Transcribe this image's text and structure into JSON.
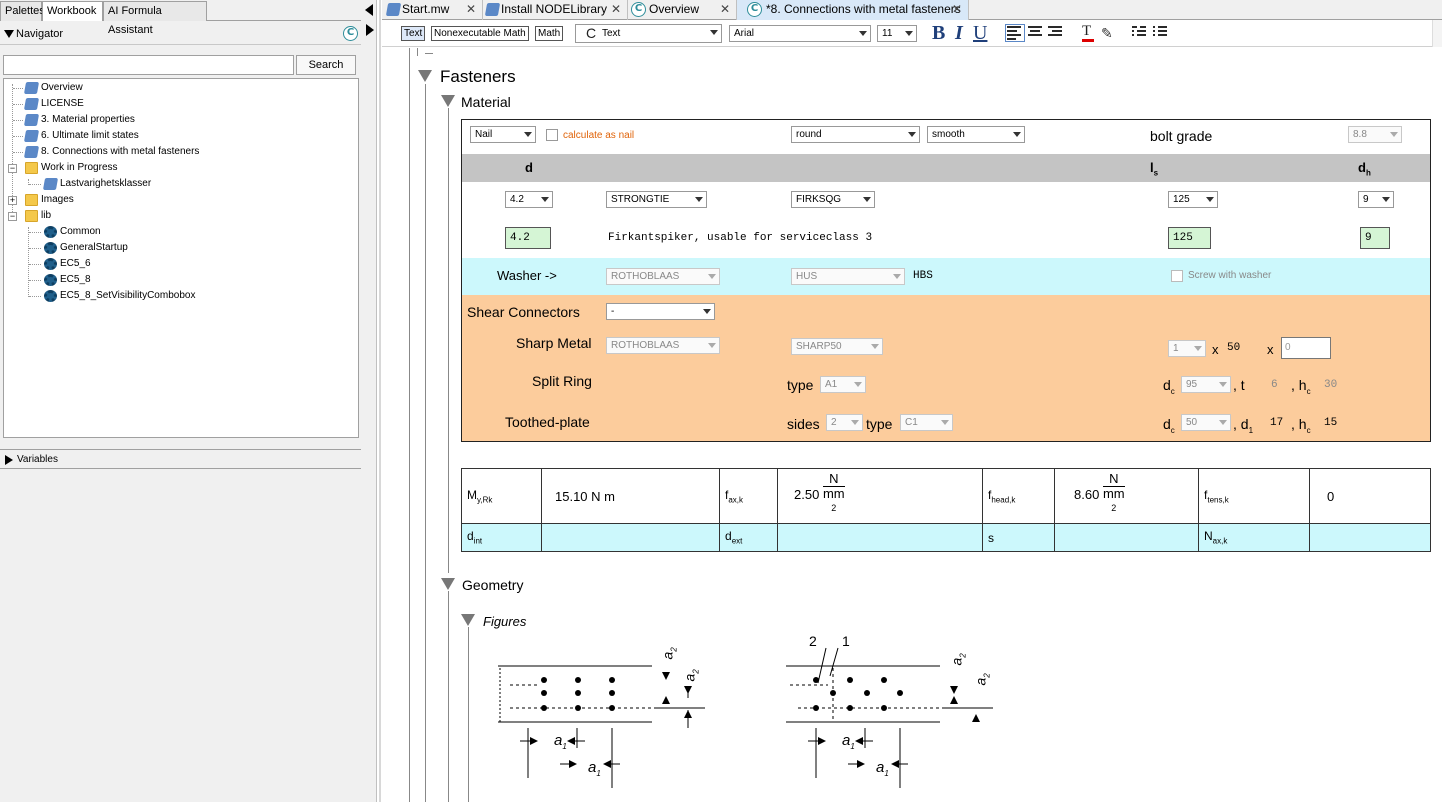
{
  "left_tabs": [
    "Palettes",
    "Workbook",
    "AI Formula Assistant"
  ],
  "navigator": {
    "title": "Navigator",
    "search_label": "Search",
    "search_value": "",
    "tree": [
      {
        "label": "Overview",
        "type": "doc",
        "level": 1
      },
      {
        "label": "LICENSE",
        "type": "doc",
        "level": 1
      },
      {
        "label": "3. Material properties",
        "type": "doc",
        "level": 1
      },
      {
        "label": "6. Ultimate limit states",
        "type": "doc",
        "level": 1
      },
      {
        "label": "8. Connections with metal fasteners",
        "type": "doc",
        "level": 1
      },
      {
        "label": "Work in Progress",
        "type": "folder",
        "level": 1
      },
      {
        "label": "Lastvarighetsklasser",
        "type": "doc",
        "level": 2
      },
      {
        "label": "Images",
        "type": "folder",
        "level": 1
      },
      {
        "label": "lib",
        "type": "folder",
        "level": 1
      },
      {
        "label": "Common",
        "type": "gear",
        "level": 2
      },
      {
        "label": "GeneralStartup",
        "type": "gear",
        "level": 2
      },
      {
        "label": "EC5_6",
        "type": "gear",
        "level": 2
      },
      {
        "label": "EC5_8",
        "type": "gear",
        "level": 2
      },
      {
        "label": "EC5_8_SetVisibilityCombobox",
        "type": "gear",
        "level": 2
      }
    ],
    "variables_label": "Variables"
  },
  "doc_tabs": [
    "Start.mw",
    "Install NODELibrary",
    "Overview",
    "*8. Connections with metal fasteners"
  ],
  "toolbar": {
    "text_btn": "Text",
    "nonexec_btn": "Nonexecutable Math",
    "math_btn": "Math",
    "style": "Text",
    "font": "Arial",
    "size": "11",
    "bold": "B",
    "italic": "I",
    "underline": "U"
  },
  "sections": {
    "fasteners": "Fasteners",
    "material": "Material",
    "geometry": "Geometry",
    "figures": "Figures"
  },
  "material": {
    "type_combo": "Nail",
    "calc_as_nail": "calculate as nail",
    "shape_combo": "round",
    "surface_combo": "smooth",
    "bolt_grade_label": "bolt grade",
    "bolt_grade": "8.8",
    "col_d": "d",
    "col_ls": "l",
    "col_ls_sub": "s",
    "col_dh": "d",
    "col_dh_sub": "h",
    "d_combo": "4.2",
    "maker_combo": "STRONGTIE",
    "product_combo": "FIRKSQG",
    "ls_combo": "125",
    "dh_combo": "9",
    "d_value": "4.2",
    "description": "Firkantspiker, usable for serviceclass 3",
    "ls_value": "125",
    "dh_value": "9",
    "washer_label": "Washer ->",
    "washer_maker": "ROTHOBLAAS",
    "washer_product": "HUS",
    "washer_code": "HBS",
    "screw_with_washer": "Screw with washer",
    "shear_label": "Shear Connectors",
    "shear_combo": "-",
    "sharp_label": "Sharp Metal",
    "sharp_maker": "ROTHOBLAAS",
    "sharp_product": "SHARP50",
    "sharp_count": "1",
    "x1": "x",
    "sharp_len": "50",
    "x2": "x",
    "sharp_input": "0",
    "split_label": "Split Ring",
    "type_label": "type",
    "split_type": "A1",
    "dc_label": "d",
    "dc_sub": "c",
    "split_dc": "95",
    "t_label": ", t",
    "split_t": "6",
    "hc_label": ", h",
    "hc_sub": "c",
    "split_hc": "30",
    "tooth_label": "Toothed-plate",
    "sides_label": "sides",
    "tooth_sides": "2",
    "tooth_type_label": "type",
    "tooth_type": "C1",
    "tooth_dc": "50",
    "d1_label": ", d",
    "d1_sub": "1",
    "tooth_d1": "17",
    "tooth_hc_label": ", h",
    "tooth_hc": "15"
  },
  "results": {
    "my_label": "M",
    "my_sub": "y,Rk",
    "my_value": "15.10 N m",
    "fax_label": "f",
    "fax_sub": "ax,k",
    "fax_value": "2.50",
    "fax_num": "N",
    "fax_den": "mm",
    "fax_exp": "2",
    "fhead_label": "f",
    "fhead_sub": "head,k",
    "fhead_value": "8.60",
    "fhead_num": "N",
    "fhead_den": "mm",
    "fhead_exp": "2",
    "ftens_label": "f",
    "ftens_sub": "tens,k",
    "ftens_value": "0",
    "dint_label": "d",
    "dint_sub": "int",
    "dext_label": "d",
    "dext_sub": "ext",
    "s_label": "s",
    "nax_label": "N",
    "nax_sub": "ax,k"
  },
  "figure": {
    "a1": "a",
    "a1_sub": "1",
    "a2": "a",
    "a2_sub": "2",
    "label_2": "2",
    "label_1": "1"
  }
}
